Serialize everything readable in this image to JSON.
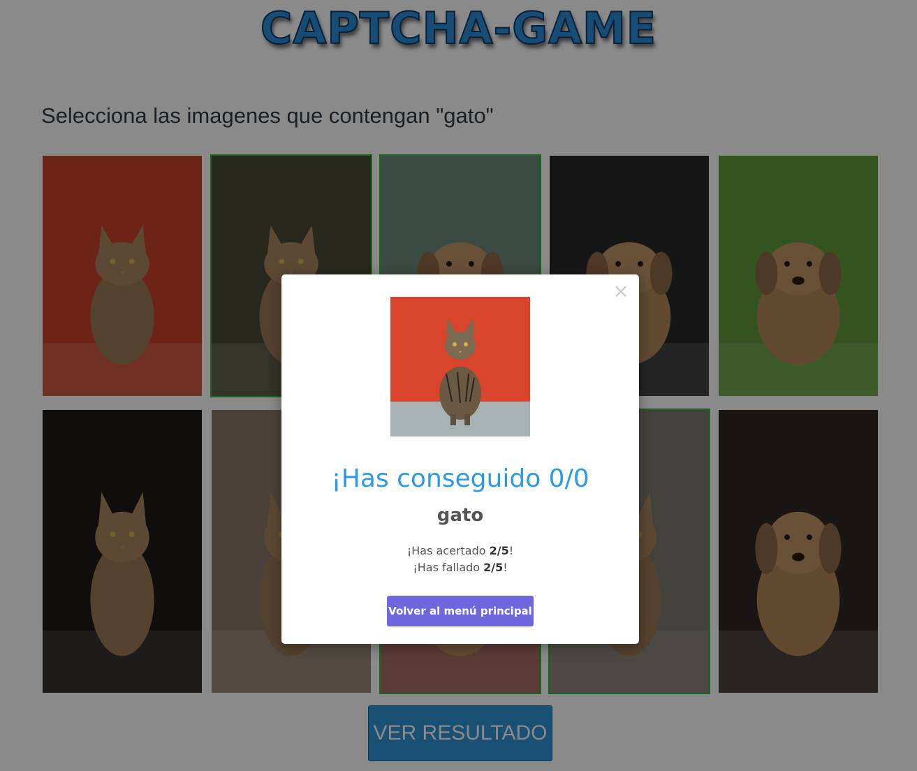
{
  "title": "CAPTCHA-GAME",
  "instruction": "Selecciona las imagenes que contengan \"gato\"",
  "tiles": [
    {
      "subject": "cat",
      "selected": false,
      "bg": "#c9432a"
    },
    {
      "subject": "cat",
      "selected": true,
      "bg": "#4b4a3a"
    },
    {
      "subject": "dog",
      "selected": true,
      "bg": "#6e8a7b"
    },
    {
      "subject": "dog",
      "selected": false,
      "bg": "#2a2a2a"
    },
    {
      "subject": "dog",
      "selected": false,
      "bg": "#5f9b3a"
    },
    {
      "subject": "cat",
      "selected": false,
      "bg": "#1e1a17"
    },
    {
      "subject": "cat",
      "selected": false,
      "bg": "#8a7a6b"
    },
    {
      "subject": "dog",
      "selected": true,
      "bg": "#9a5a52"
    },
    {
      "subject": "cat",
      "selected": true,
      "bg": "#7f7a70"
    },
    {
      "subject": "dog",
      "selected": false,
      "bg": "#2f2a24"
    }
  ],
  "result_button": "VER RESULTADO",
  "modal": {
    "close": "×",
    "title": "¡Has conseguido 0/0",
    "word": "gato",
    "hits_prefix": "¡Has acertado ",
    "hits_value": "2/5",
    "hits_suffix": "!",
    "misses_prefix": "¡Has fallado ",
    "misses_value": "2/5",
    "misses_suffix": "!",
    "button": "Volver al menú principal"
  },
  "colors": {
    "title": "#2b8fd6",
    "selected_border": "#27c234",
    "modal_title": "#2c9ae6",
    "modal_button": "#7066e0"
  }
}
